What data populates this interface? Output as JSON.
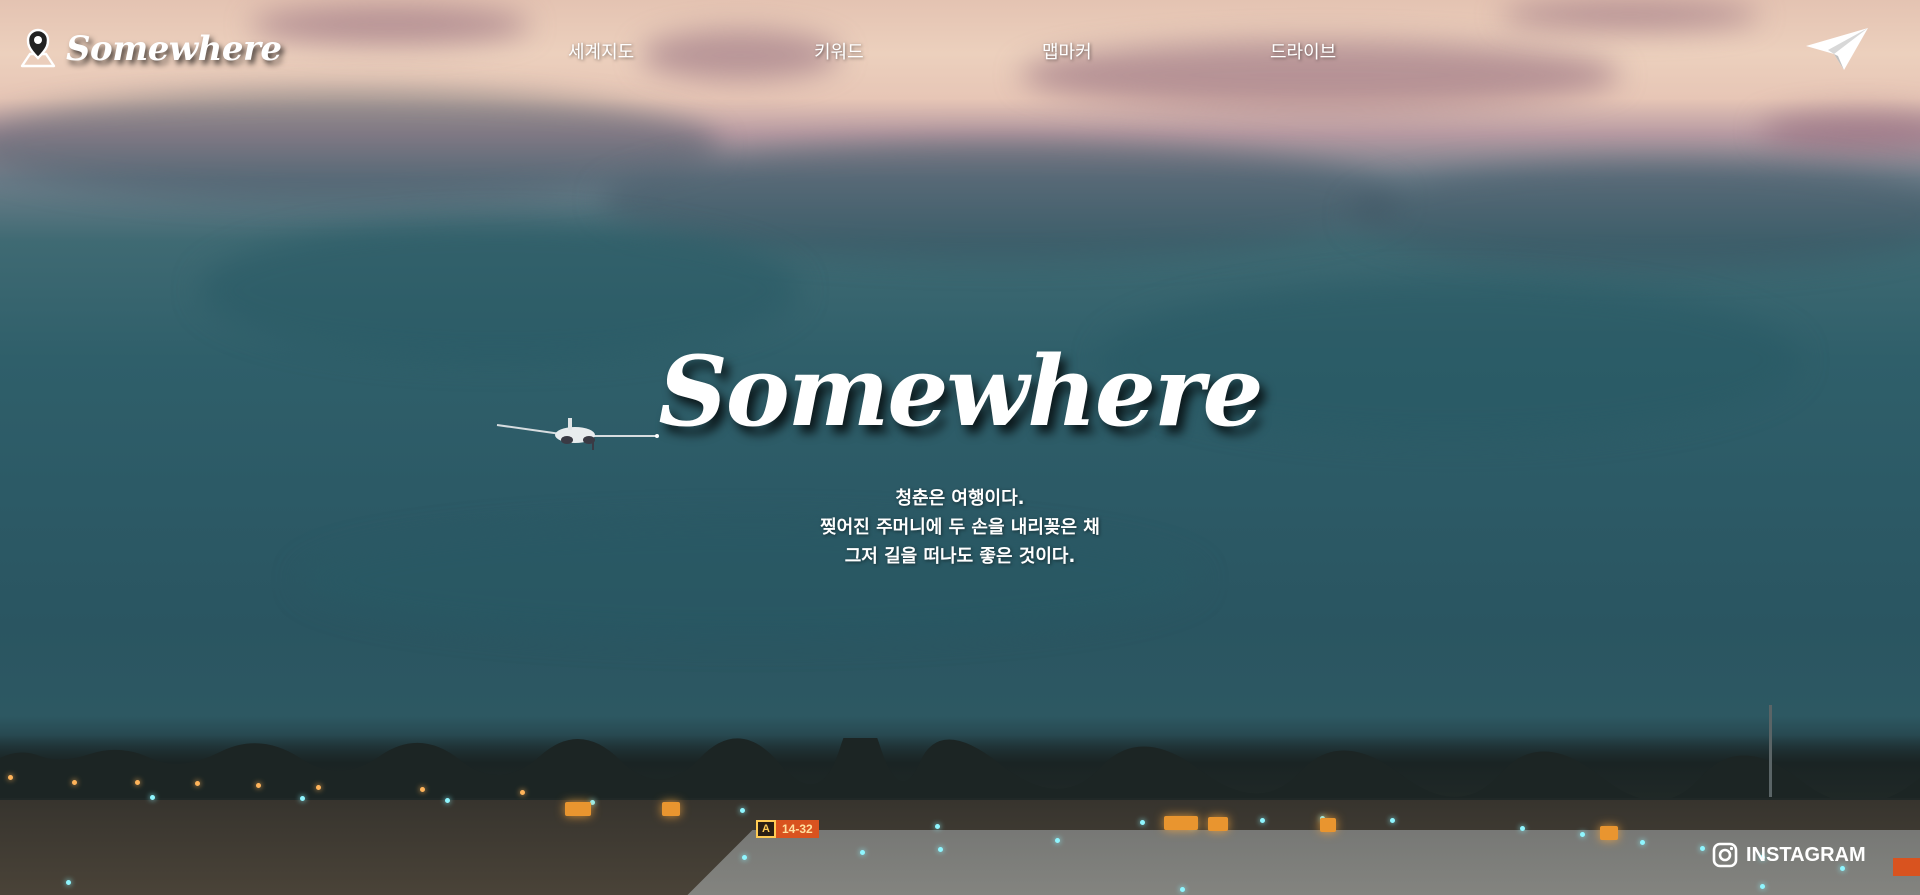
{
  "brand": {
    "name": "Somewhere",
    "logo_icon": "map-pin-icon"
  },
  "nav": {
    "items": [
      {
        "label": "세계지도"
      },
      {
        "label": "키워드"
      },
      {
        "label": "맵마커"
      },
      {
        "label": "드라이브"
      }
    ],
    "send_icon": "paper-plane-icon"
  },
  "hero": {
    "title": "Somewhere",
    "tagline": [
      "청춘은 여행이다.",
      "찢어진 주머니에 두 손을 내리꽂은 채",
      "그저 길을 떠나도 좋은 것이다."
    ]
  },
  "background": {
    "sign_letter": "A",
    "sign_number": "14-32"
  },
  "social": {
    "instagram_label": "INSTAGRAM",
    "instagram_icon": "instagram-icon"
  }
}
